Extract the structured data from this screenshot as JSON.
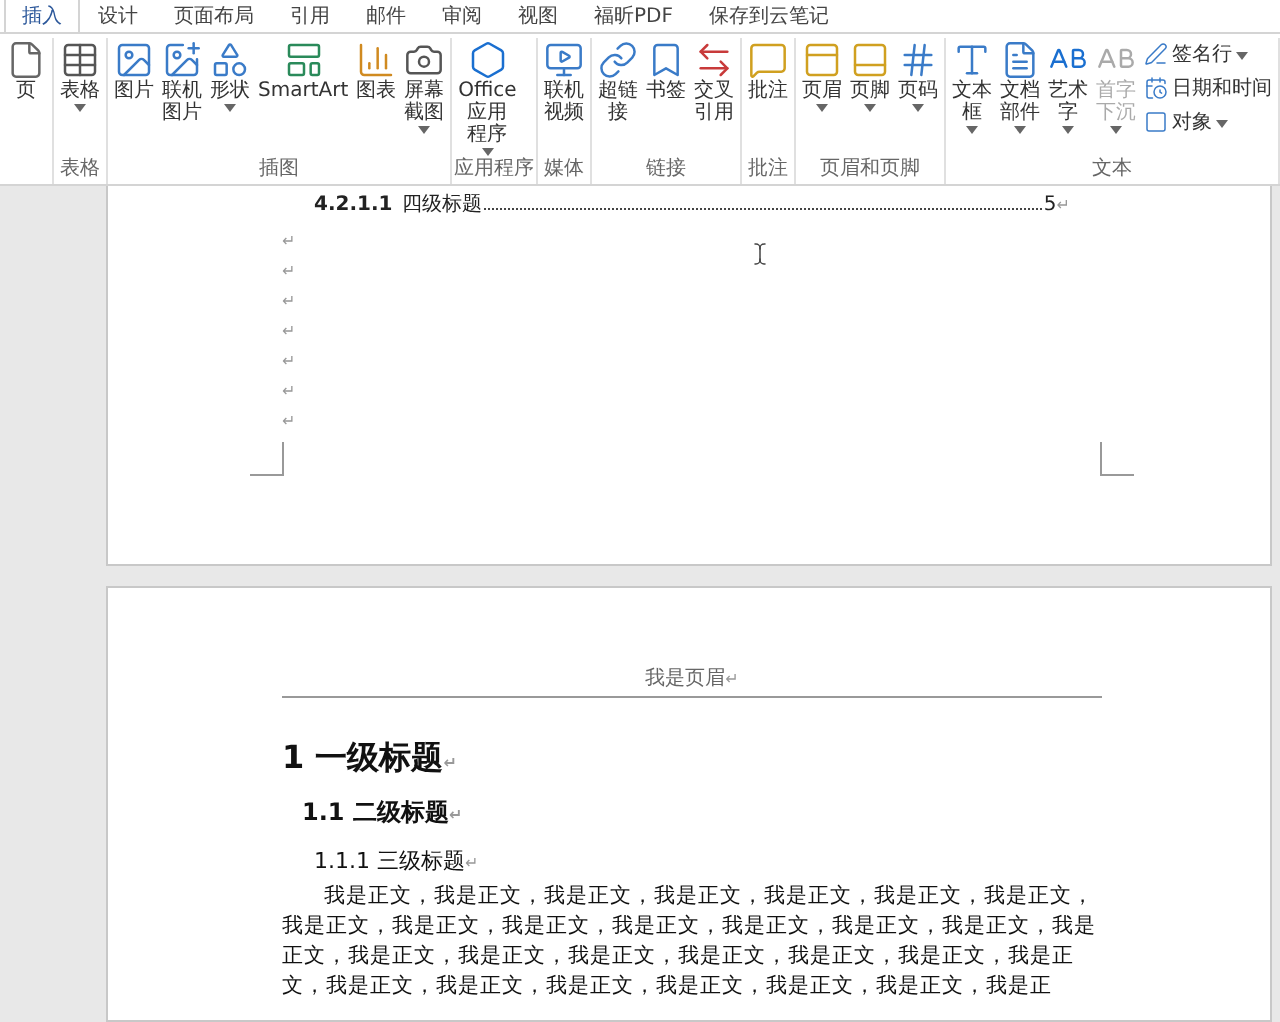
{
  "tabs": [
    {
      "label": "插入",
      "selected": true
    },
    {
      "label": "设计",
      "selected": false
    },
    {
      "label": "页面布局",
      "selected": false
    },
    {
      "label": "引用",
      "selected": false
    },
    {
      "label": "邮件",
      "selected": false
    },
    {
      "label": "审阅",
      "selected": false
    },
    {
      "label": "视图",
      "selected": false
    },
    {
      "label": "福昕PDF",
      "selected": false
    },
    {
      "label": "保存到云笔记",
      "selected": false
    }
  ],
  "ribbon_groups": [
    {
      "buttons": [
        {
          "label": "页",
          "dropdown": false,
          "disabled": false
        }
      ]
    },
    {
      "label": "表格",
      "buttons": [
        {
          "label": "表格",
          "dropdown": true,
          "disabled": false
        }
      ]
    },
    {
      "label": "插图",
      "buttons": [
        {
          "label": "图片",
          "dropdown": false,
          "disabled": false
        },
        {
          "label": "联机图片",
          "dropdown": false,
          "disabled": false
        },
        {
          "label": "形状",
          "dropdown": true,
          "disabled": false
        },
        {
          "label": "SmartArt",
          "dropdown": false,
          "disabled": false
        },
        {
          "label": "图表",
          "dropdown": false,
          "disabled": false
        },
        {
          "label": "屏幕截图",
          "dropdown": true,
          "disabled": false
        }
      ]
    },
    {
      "label": "应用程序",
      "buttons": [
        {
          "label": "Office 应用程序",
          "dropdown": true,
          "disabled": false
        }
      ]
    },
    {
      "label": "媒体",
      "buttons": [
        {
          "label": "联机视频",
          "dropdown": false,
          "disabled": false
        }
      ]
    },
    {
      "label": "链接",
      "buttons": [
        {
          "label": "超链接",
          "dropdown": false,
          "disabled": false
        },
        {
          "label": "书签",
          "dropdown": false,
          "disabled": false
        },
        {
          "label": "交叉引用",
          "dropdown": false,
          "disabled": false
        }
      ]
    },
    {
      "label": "批注",
      "buttons": [
        {
          "label": "批注",
          "dropdown": false,
          "disabled": false
        }
      ]
    },
    {
      "label": "页眉和页脚",
      "buttons": [
        {
          "label": "页眉",
          "dropdown": true,
          "disabled": false
        },
        {
          "label": "页脚",
          "dropdown": true,
          "disabled": false
        },
        {
          "label": "页码",
          "dropdown": true,
          "disabled": false
        }
      ]
    },
    {
      "label": "文本",
      "buttons": [
        {
          "label": "文本框",
          "dropdown": true,
          "disabled": false
        },
        {
          "label": "文档部件",
          "dropdown": true,
          "disabled": false
        },
        {
          "label": "艺术字",
          "dropdown": true,
          "disabled": false
        },
        {
          "label": "首字下沉",
          "dropdown": true,
          "disabled": true
        }
      ],
      "small_buttons": [
        {
          "label": "签名行",
          "dropdown": true
        },
        {
          "label": "日期和时间",
          "dropdown": false
        },
        {
          "label": "对象",
          "dropdown": true
        }
      ]
    }
  ],
  "page_1": {
    "toc_entry": {
      "number": "4.2.1.1",
      "title": "四级标题",
      "page": "5",
      "mark": "↵"
    },
    "empty_paragraphs": [
      "↵",
      "↵",
      "↵",
      "↵",
      "↵",
      "↵",
      "↵"
    ]
  },
  "page_2": {
    "header": "我是页眉",
    "header_mark": "↵",
    "headings": [
      {
        "number": "1",
        "text": "一级标题",
        "mark": "↵"
      },
      {
        "number": "1.1",
        "text": "二级标题",
        "mark": "↵"
      },
      {
        "number": "1.1.1",
        "text": "三级标题",
        "mark": "↵"
      }
    ],
    "body": "我是正文，我是正文，我是正文，我是正文，我是正文，我是正文，我是正文，我是正文，我是正文，我是正文，我是正文，我是正文，我是正文，我是正文，我是正文，我是正文，我是正文，我是正文，我是正文，我是正文，我是正文，我是正文，我是正文，我是正文，我是正文，我是正文，我是正文，我是正文，我是正"
  }
}
